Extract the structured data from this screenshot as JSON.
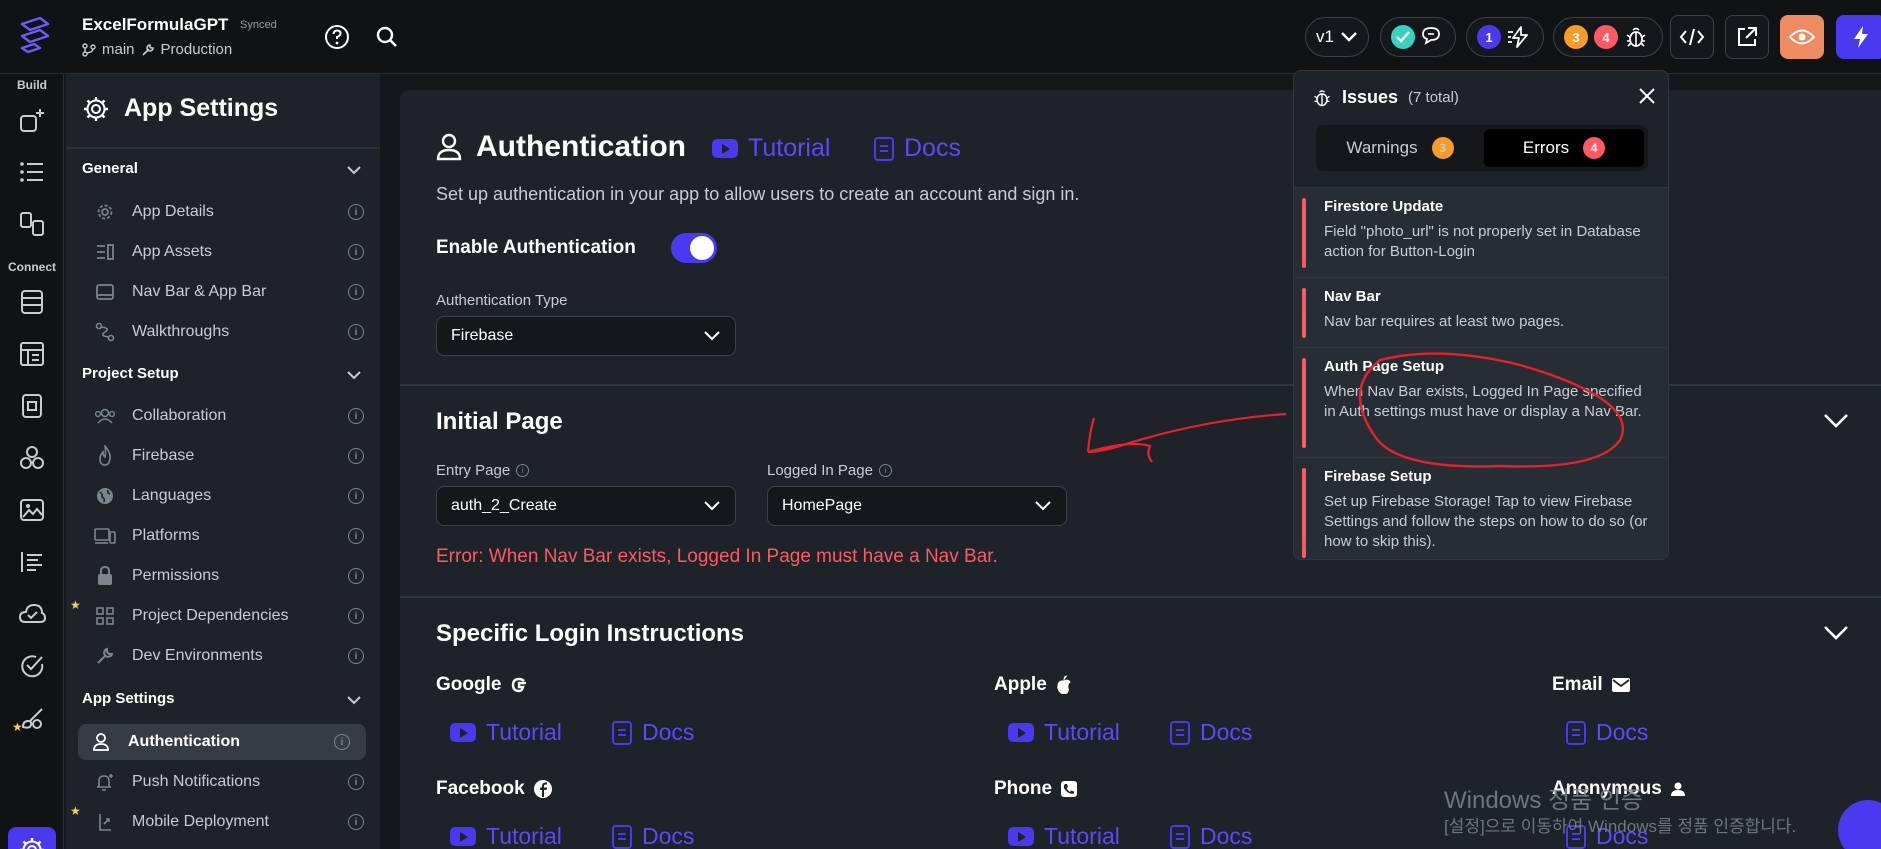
{
  "header": {
    "project_name": "ExcelFormulaGPT",
    "synced": "Synced",
    "branch": "main",
    "environment": "Production",
    "version": "v1",
    "issues_badge_1": "1",
    "warnings_count": "3",
    "errors_count": "4"
  },
  "rail": {
    "build_label": "Build",
    "connect_label": "Connect"
  },
  "sidebar": {
    "title": "App Settings",
    "sections": {
      "general": "General",
      "project_setup": "Project Setup",
      "app_settings": "App Settings"
    },
    "general_items": [
      "App Details",
      "App Assets",
      "Nav Bar & App Bar",
      "Walkthroughs"
    ],
    "project_items": [
      "Collaboration",
      "Firebase",
      "Languages",
      "Platforms",
      "Permissions",
      "Project Dependencies",
      "Dev Environments"
    ],
    "app_items": [
      "Authentication",
      "Push Notifications",
      "Mobile Deployment"
    ]
  },
  "main": {
    "title": "Authentication",
    "tutorial": "Tutorial",
    "docs": "Docs",
    "description": "Set up authentication in your app to allow users to create an account and sign in.",
    "enable_label": "Enable Authentication",
    "enable_on": true,
    "auth_type_label": "Authentication Type",
    "auth_type_value": "Firebase",
    "initial_page_title": "Initial Page",
    "entry_page_label": "Entry Page",
    "entry_page_value": "auth_2_Create",
    "logged_in_label": "Logged In Page",
    "logged_in_value": "HomePage",
    "error_text": "Error: When Nav Bar exists, Logged In Page must have a Nav Bar.",
    "login_title": "Specific Login Instructions",
    "providers": [
      "Google",
      "Apple",
      "Email",
      "Facebook",
      "Phone",
      "Anonymous"
    ]
  },
  "issues_popup": {
    "title": "Issues",
    "total": "(7 total)",
    "tab_warnings": "Warnings",
    "tab_errors": "Errors",
    "items": [
      {
        "title": "Firestore Update",
        "desc": "Field \"photo_url\" is not properly set in Database action for Button-Login"
      },
      {
        "title": "Nav Bar",
        "desc": "Nav bar requires at least two pages."
      },
      {
        "title": "Auth Page Setup",
        "desc": "When Nav Bar exists, Logged In Page specified in Auth settings must have or display a Nav Bar."
      },
      {
        "title": "Firebase Setup",
        "desc": "Set up Firebase Storage! Tap to view Firebase Settings and follow the steps on how to do so (or how to skip this)."
      }
    ]
  },
  "watermark": {
    "line1": "Windows 정품 인증",
    "line2": "[설정]으로 이동하여 Windows를 정품 인증합니다."
  },
  "colors": {
    "accent": "#4b39ef",
    "error": "#ff5963",
    "warning": "#f89b29",
    "success": "#39d2c0"
  }
}
